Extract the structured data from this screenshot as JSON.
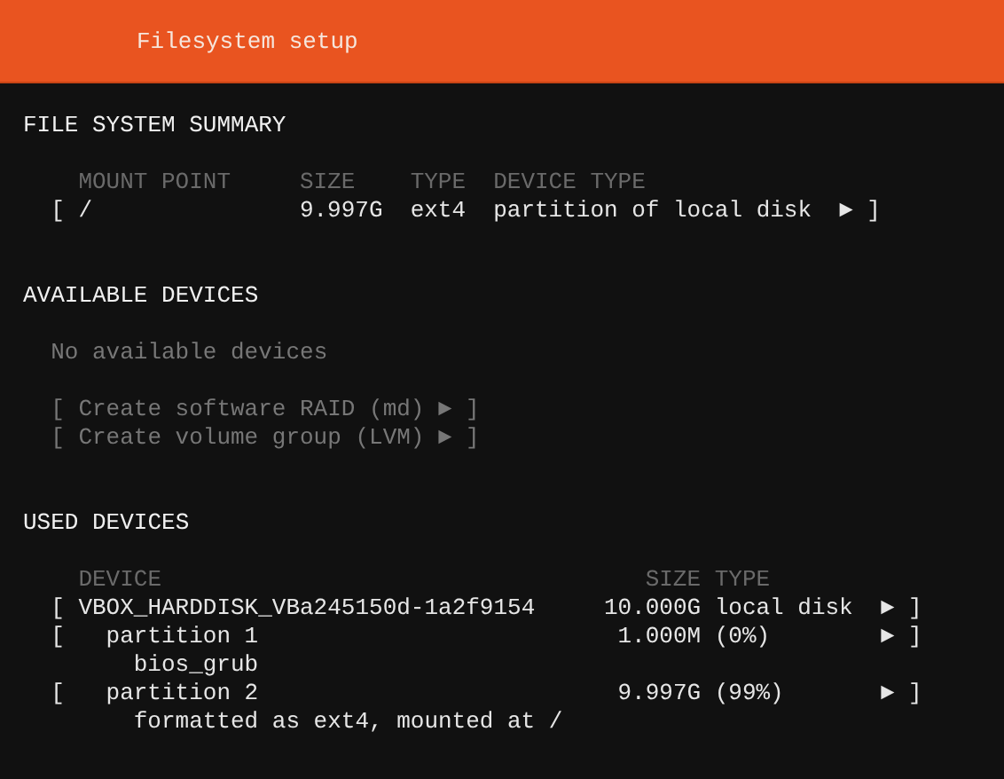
{
  "header": {
    "title": "Filesystem setup"
  },
  "summary": {
    "heading": "FILE SYSTEM SUMMARY",
    "columns": [
      "MOUNT POINT",
      "SIZE",
      "TYPE",
      "DEVICE TYPE"
    ],
    "rows": [
      {
        "open": "[",
        "mount_point": "/",
        "size": "9.997G",
        "type": "ext4",
        "device_type": "partition of local disk",
        "arrow": "►",
        "close": "]"
      }
    ]
  },
  "available": {
    "heading": "AVAILABLE DEVICES",
    "empty_message": "No available devices",
    "actions": [
      {
        "open": "[",
        "label": "Create software RAID (md)",
        "arrow": "►",
        "close": "]",
        "disabled": true
      },
      {
        "open": "[",
        "label": "Create volume group (LVM)",
        "arrow": "►",
        "close": "]",
        "disabled": true
      }
    ]
  },
  "used": {
    "heading": "USED DEVICES",
    "columns": [
      "DEVICE",
      "SIZE",
      "TYPE"
    ],
    "rows": [
      {
        "kind": "disk",
        "open": "[",
        "device": "VBOX_HARDDISK_VBa245150d-1a2f9154",
        "size": "10.000G",
        "type": "local disk",
        "arrow": "►",
        "close": "]"
      },
      {
        "kind": "partition",
        "open": "[",
        "device": "partition 1",
        "size": "1.000M",
        "type": "(0%)",
        "arrow": "►",
        "close": "]",
        "note": "bios_grub"
      },
      {
        "kind": "partition",
        "open": "[",
        "device": "partition 2",
        "size": "9.997G",
        "type": "(99%)",
        "arrow": "►",
        "close": "]",
        "note": "formatted as ext4, mounted at /"
      }
    ]
  }
}
